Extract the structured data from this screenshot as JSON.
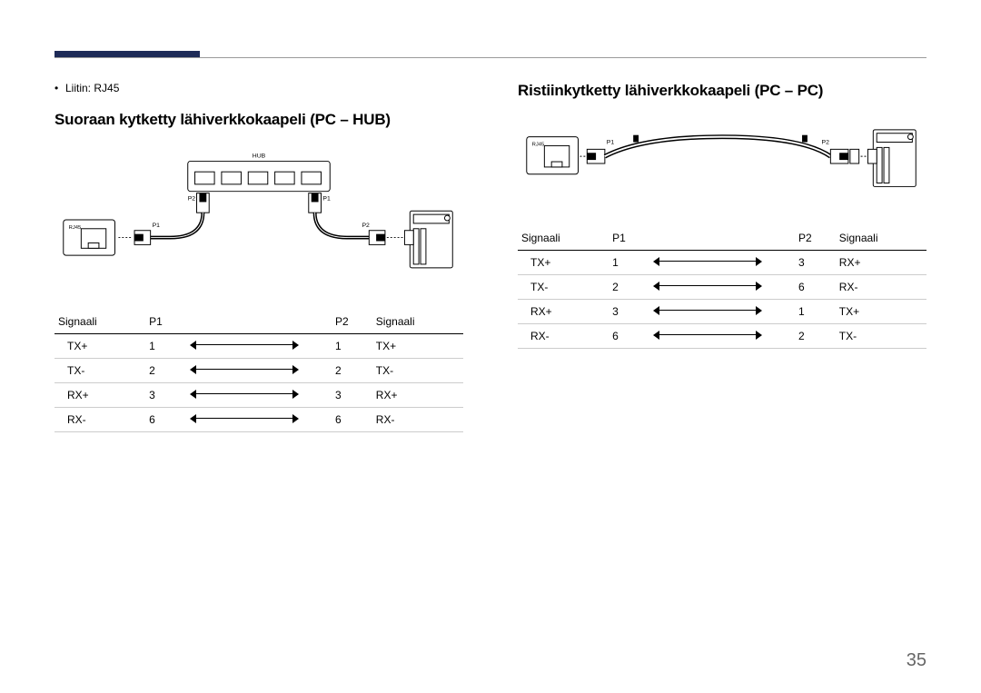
{
  "page_number": "35",
  "connector_bullet": "Liitin: RJ45",
  "left": {
    "heading": "Suoraan kytketty lähiverkkokaapeli (PC – HUB)",
    "diagram_labels": {
      "hub": "HUB",
      "rj45": "RJ45",
      "p1": "P1",
      "p2": "P2"
    },
    "table": {
      "headers": [
        "Signaali",
        "P1",
        "P2",
        "Signaali"
      ],
      "rows": [
        {
          "sig1": "TX+",
          "p1": "1",
          "p2": "1",
          "sig2": "TX+"
        },
        {
          "sig1": "TX-",
          "p1": "2",
          "p2": "2",
          "sig2": "TX-"
        },
        {
          "sig1": "RX+",
          "p1": "3",
          "p2": "3",
          "sig2": "RX+"
        },
        {
          "sig1": "RX-",
          "p1": "6",
          "p2": "6",
          "sig2": "RX-"
        }
      ]
    }
  },
  "right": {
    "heading": "Ristiinkytketty lähiverkkokaapeli (PC – PC)",
    "diagram_labels": {
      "rj45": "RJ45",
      "p1": "P1",
      "p2": "P2"
    },
    "table": {
      "headers": [
        "Signaali",
        "P1",
        "P2",
        "Signaali"
      ],
      "rows": [
        {
          "sig1": "TX+",
          "p1": "1",
          "p2": "3",
          "sig2": "RX+"
        },
        {
          "sig1": "TX-",
          "p1": "2",
          "p2": "6",
          "sig2": "RX-"
        },
        {
          "sig1": "RX+",
          "p1": "3",
          "p2": "1",
          "sig2": "TX+"
        },
        {
          "sig1": "RX-",
          "p1": "6",
          "p2": "2",
          "sig2": "TX-"
        }
      ]
    }
  }
}
